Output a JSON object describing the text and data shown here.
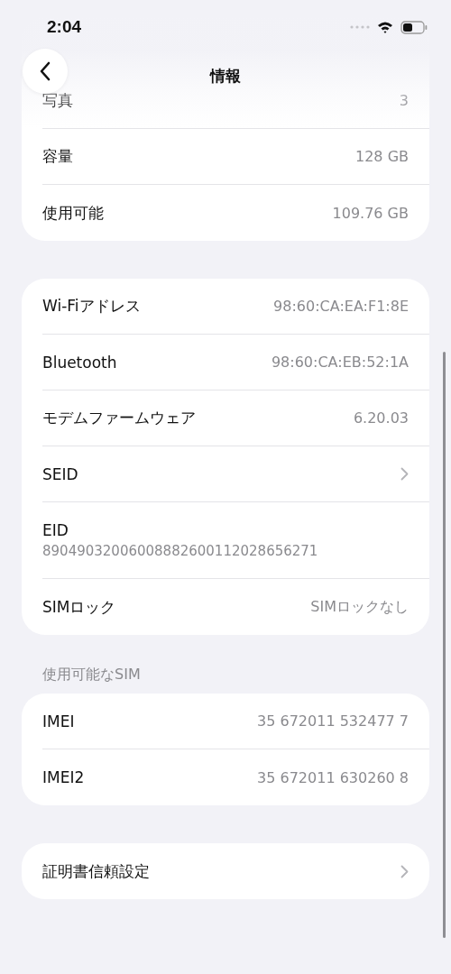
{
  "status_bar": {
    "time": "2:04"
  },
  "nav": {
    "title": "情報"
  },
  "sections": [
    {
      "rows": [
        {
          "kind": "value",
          "label": "写真",
          "value": "3"
        },
        {
          "kind": "value",
          "label": "容量",
          "value": "128 GB"
        },
        {
          "kind": "value",
          "label": "使用可能",
          "value": "109.76 GB"
        }
      ]
    },
    {
      "rows": [
        {
          "kind": "value",
          "label": "Wi-Fiアドレス",
          "value": "98:60:CA:EA:F1:8E"
        },
        {
          "kind": "value",
          "label": "Bluetooth",
          "value": "98:60:CA:EB:52:1A"
        },
        {
          "kind": "value",
          "label": "モデムファームウェア",
          "value": "6.20.03"
        },
        {
          "kind": "link",
          "label": "SEID"
        },
        {
          "kind": "stacked",
          "label": "EID",
          "value": "89049032006008882600112028656271"
        },
        {
          "kind": "value",
          "label": "SIMロック",
          "value": "SIMロックなし"
        }
      ]
    },
    {
      "header": "使用可能なSIM",
      "rows": [
        {
          "kind": "value",
          "label": "IMEI",
          "value": "35 672011 532477 7"
        },
        {
          "kind": "value",
          "label": "IMEI2",
          "value": "35 672011 630260 8"
        }
      ]
    },
    {
      "rows": [
        {
          "kind": "link",
          "label": "証明書信頼設定"
        }
      ]
    }
  ]
}
